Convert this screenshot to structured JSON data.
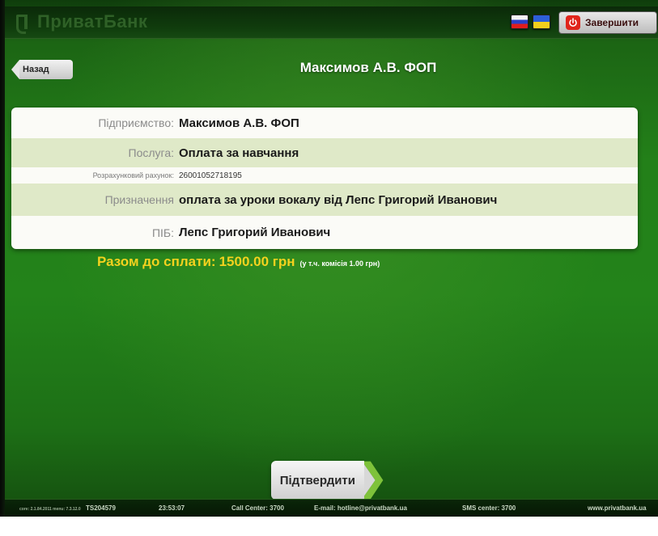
{
  "header": {
    "logo_text": "ПриватБанк",
    "exit_label": "Завершити",
    "flags": [
      "ru-flag",
      "ua-flag"
    ]
  },
  "nav": {
    "back_label": "Назад",
    "title": "Максимов А.В. ФОП"
  },
  "details": [
    {
      "label": "Підприємство:",
      "value": "Максимов А.В. ФОП"
    },
    {
      "label": "Послуга:",
      "value": "Оплата за навчання"
    },
    {
      "label": "Розрахунковий рахунок:",
      "value": "26001052718195"
    },
    {
      "label": "Призначення",
      "value": "оплата за уроки вокалу від Лепс Григорий Иванович"
    },
    {
      "label": "ПІБ:",
      "value": "Лепс Григорий Иванович"
    }
  ],
  "total": {
    "label": "Разом до сплати:",
    "amount": "1500.00 грн",
    "note": "(у т.ч. комісія 1.00 грн)"
  },
  "confirm_label": "Підтвердити",
  "footer": {
    "versions": "core: 2.1.84.2011  menu: 7.3.12.0",
    "terminal": "TS204579",
    "time": "23:53:07",
    "call_center": "Call Center: 3700",
    "email": "E-mail: hotline@privatbank.ua",
    "sms_center": "SMS center: 3700",
    "website": "www.privatbank.ua"
  },
  "colors": {
    "background": "#238019",
    "accent_yellow": "#f4d21e",
    "highlight_row": "#dfe9c8",
    "exit_red": "#e0251b"
  }
}
